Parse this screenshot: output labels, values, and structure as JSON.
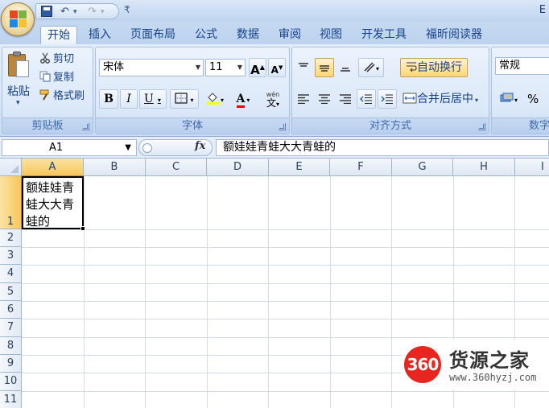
{
  "window": {
    "title": "E"
  },
  "qat": {
    "undo": "↶",
    "redo": "↷",
    "dd": "▾",
    "customize": "₹"
  },
  "tabs": [
    "开始",
    "插入",
    "页面布局",
    "公式",
    "数据",
    "审阅",
    "视图",
    "开发工具",
    "福昕阅读器"
  ],
  "ribbon": {
    "clipboard": {
      "label": "剪贴板",
      "paste": "粘贴",
      "paste_dd": "▾",
      "cut": "剪切",
      "copy": "复制",
      "format_painter": "格式刷"
    },
    "font": {
      "label": "字体",
      "name": "宋体",
      "size": "11",
      "grow": "A",
      "shrink": "A",
      "bold": "B",
      "italic": "I",
      "underline": "U",
      "font_color_letter": "A",
      "phonetic": "wén"
    },
    "alignment": {
      "label": "对齐方式",
      "wrap_text": "自动换行",
      "merge_center": "合并后居中"
    },
    "number": {
      "label": "数字",
      "format": "常规",
      "percent": "%"
    }
  },
  "formula_bar": {
    "name_box": "A1",
    "fx": "fx",
    "content": "额娃娃青蛙大大青蛙的"
  },
  "columns": [
    "A",
    "B",
    "C",
    "D",
    "E",
    "F",
    "G",
    "H",
    "I"
  ],
  "rows": [
    "1",
    "2",
    "3",
    "4",
    "5",
    "6",
    "7",
    "8",
    "9",
    "10",
    "11"
  ],
  "cells": {
    "A1": "额娃娃青蛙大大青蛙的"
  },
  "watermark": {
    "badge": "360",
    "name": "货源之家",
    "url": "www.360hyzj.com"
  },
  "colors": {
    "accent_selected": "#f7c75a",
    "ribbon_bg": "#dbe8f8",
    "text_blue": "#15428b"
  }
}
